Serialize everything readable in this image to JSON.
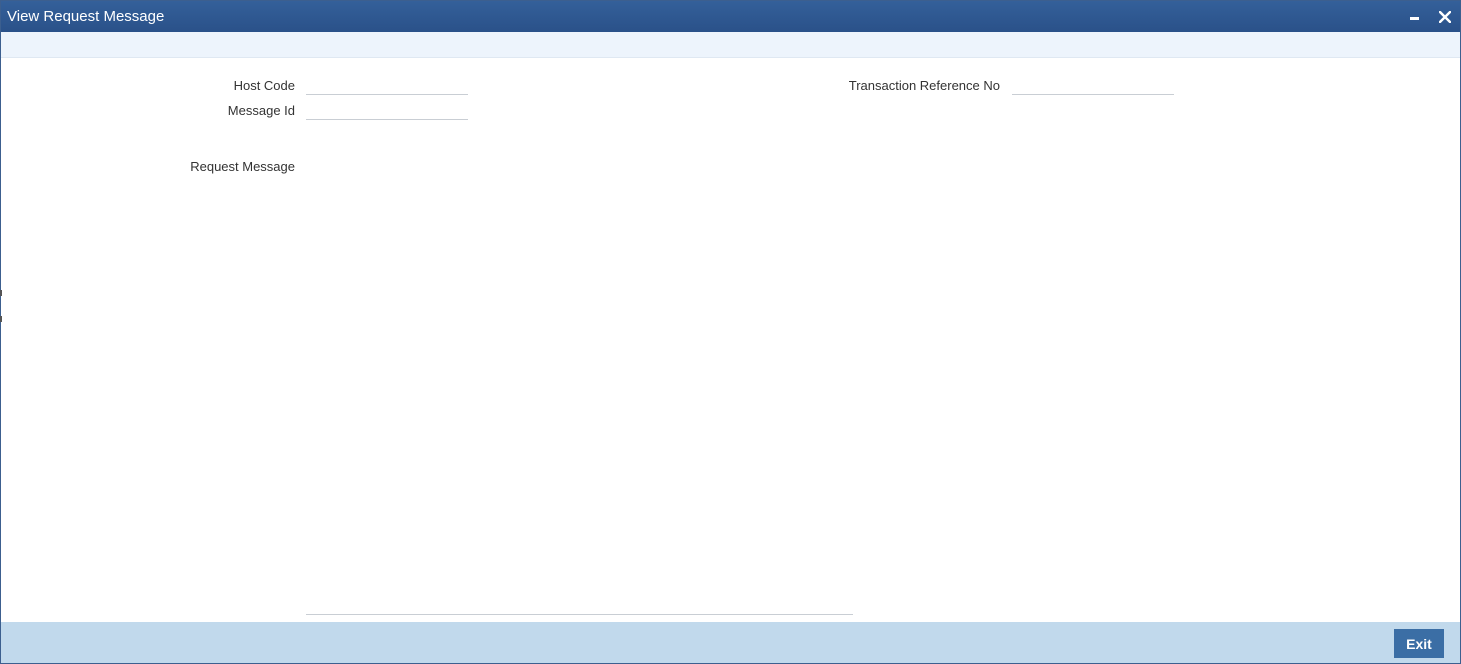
{
  "window": {
    "title": "View Request Message"
  },
  "form": {
    "host_code_label": "Host Code",
    "host_code_value": "",
    "message_id_label": "Message Id",
    "message_id_value": "",
    "transaction_ref_label": "Transaction Reference No",
    "transaction_ref_value": "",
    "request_message_label": "Request Message",
    "request_message_value": ""
  },
  "footer": {
    "exit_label": "Exit"
  },
  "icons": {
    "minimize": "minimize-icon",
    "close": "close-icon"
  },
  "colors": {
    "titlebar": "#2f5a93",
    "subbar": "#edf4fc",
    "footer": "#c1d9ec",
    "button": "#3b6ea5"
  }
}
